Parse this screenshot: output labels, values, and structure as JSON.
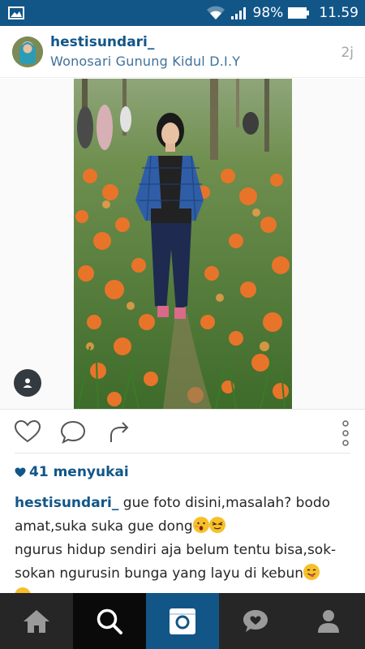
{
  "status_bar": {
    "battery": "98%",
    "time": "11.59",
    "icons": [
      "gallery-icon",
      "wifi-icon",
      "signal-icon",
      "battery-icon"
    ]
  },
  "post": {
    "username": "hestisundari_",
    "location": "Wonosari Gunung Kidul D.I.Y",
    "time_ago": "2j",
    "likes": "41 menyukai",
    "caption": {
      "username": "hestisundari_",
      "text_1": "gue foto disini,masalah? bodo amat,suka suka gue dong",
      "text_2": "ngurus hidup sendiri aja belum tentu bisa,sok-sokan ngurusin bunga yang layu di kebun"
    }
  },
  "actions": [
    "heart-icon",
    "comment-icon",
    "share-icon",
    "more-icon"
  ],
  "bottom_nav": [
    "home-icon",
    "search-icon",
    "camera-icon",
    "activity-icon",
    "profile-icon"
  ],
  "colors": {
    "brand_blue": "#125688",
    "link_blue": "#3f729b",
    "nav_dark": "#262626"
  }
}
